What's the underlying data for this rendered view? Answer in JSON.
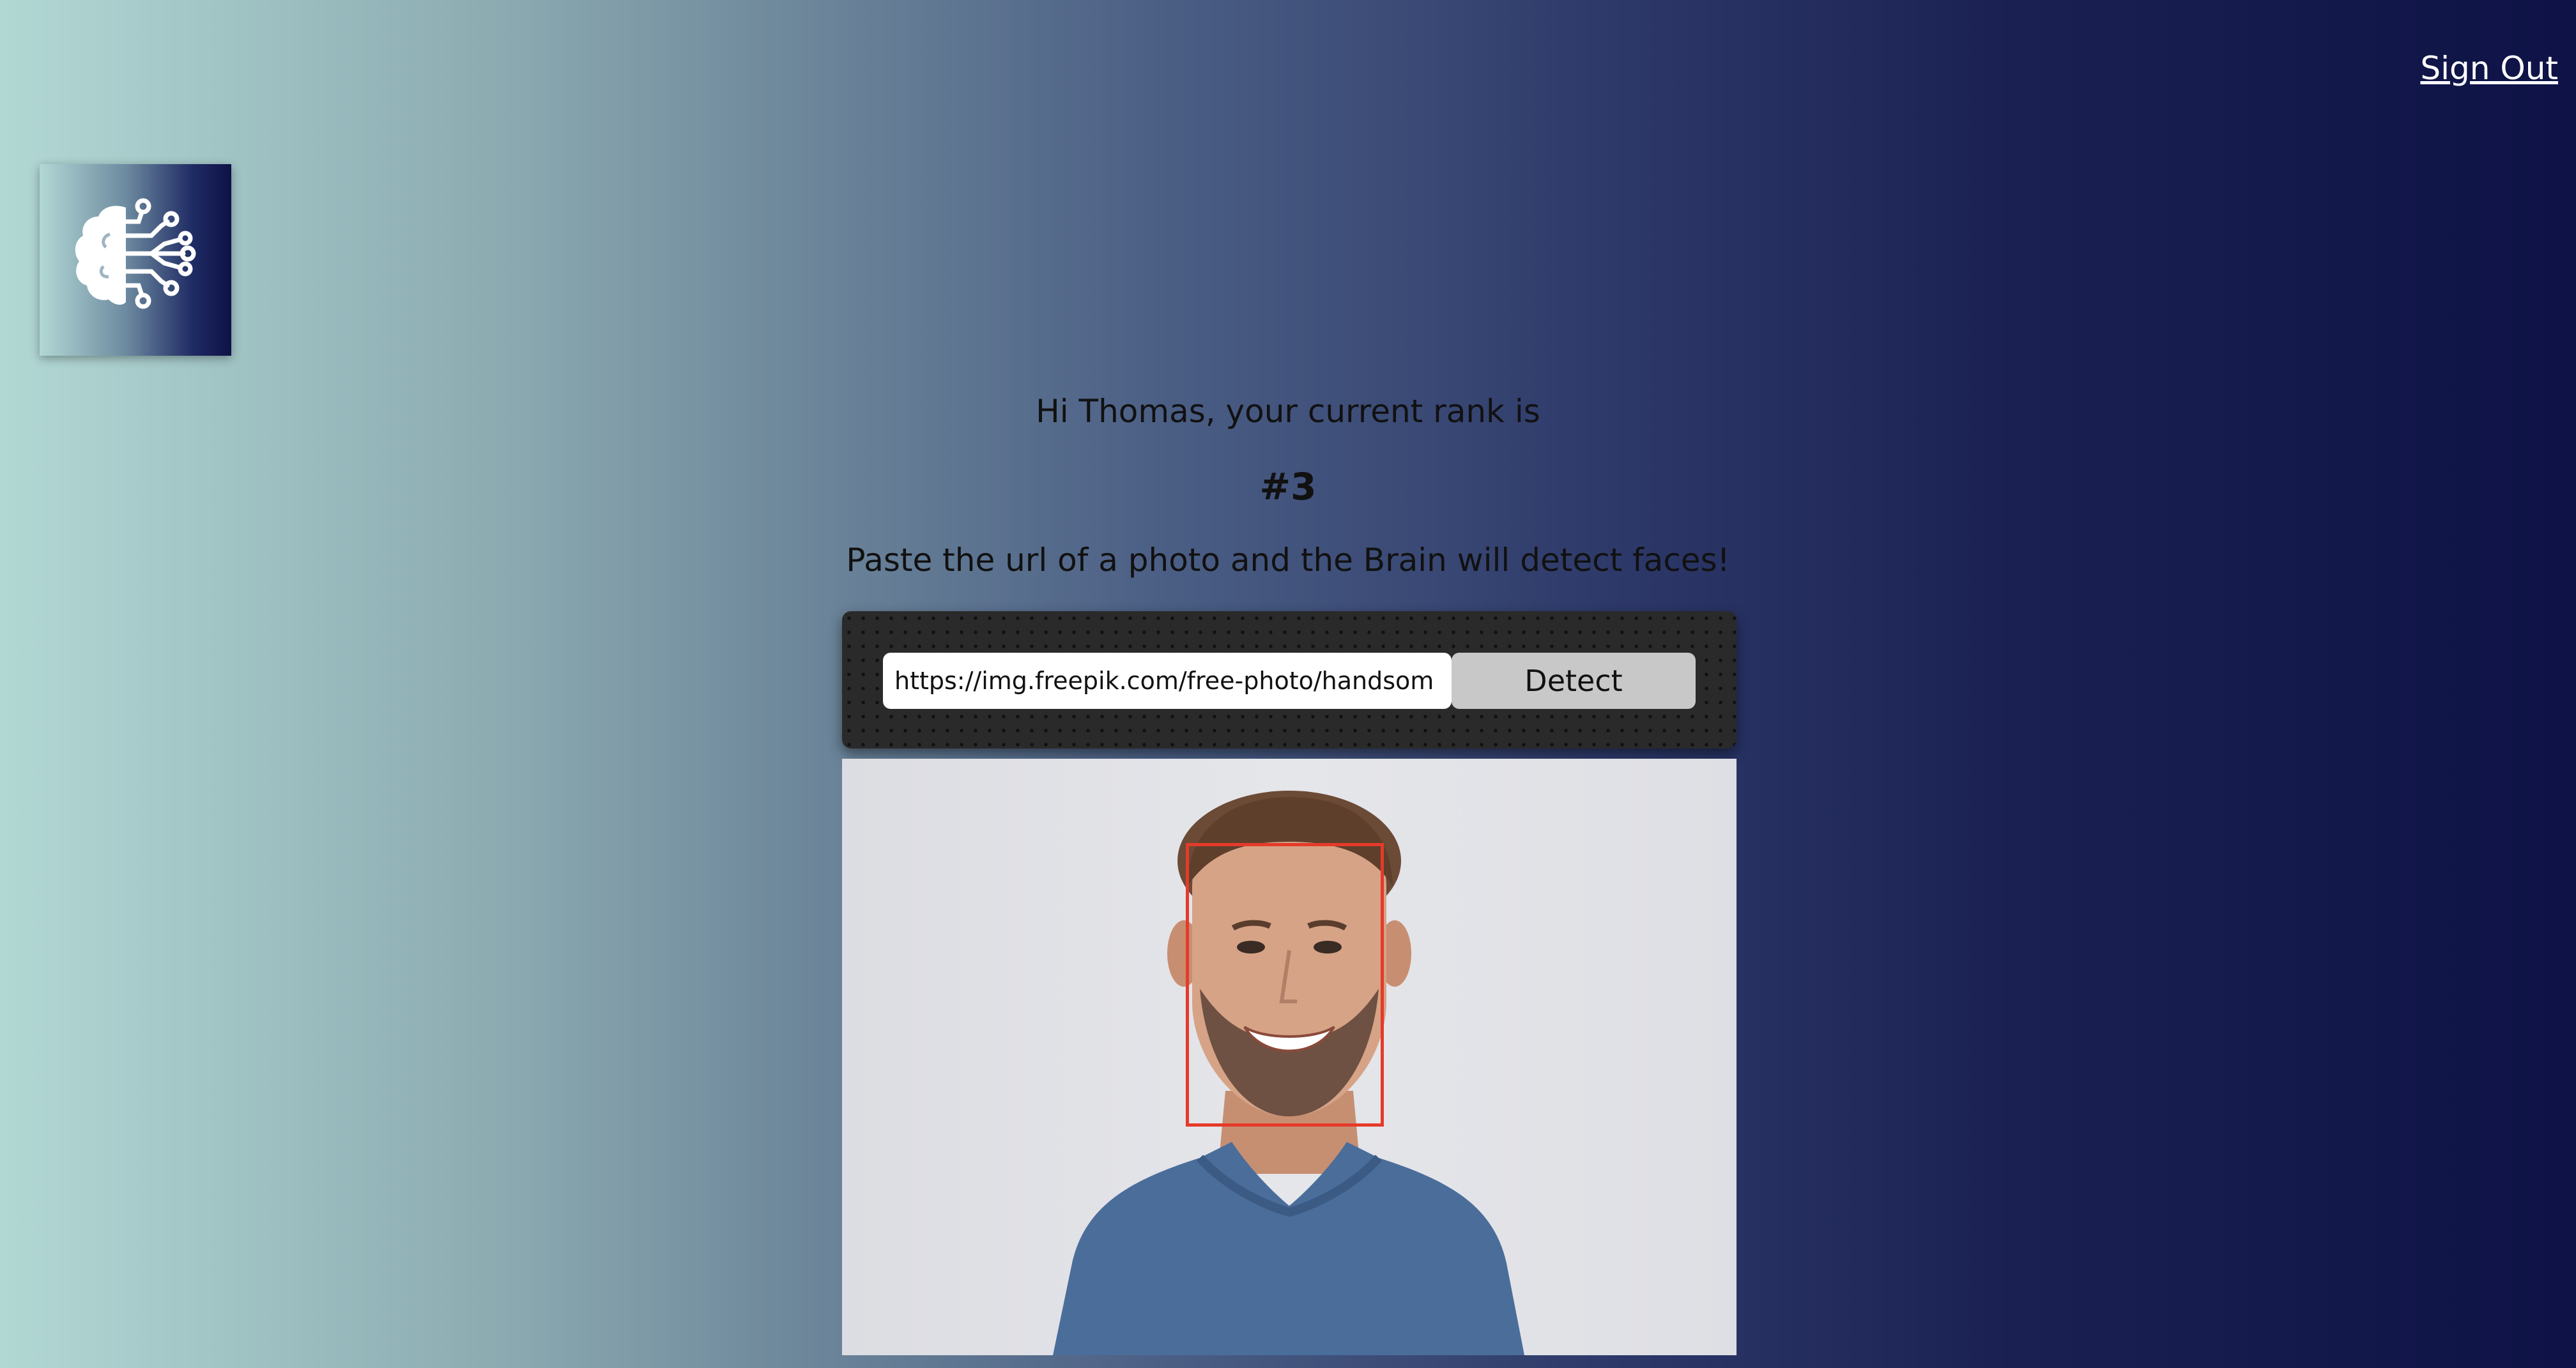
{
  "nav": {
    "sign_out": "Sign Out"
  },
  "logo": {
    "icon": "brain-circuit-icon"
  },
  "rank": {
    "greeting": "Hi Thomas, your current rank is",
    "value": "#3"
  },
  "instructions": "Paste the url of a photo and the Brain will detect faces!",
  "form": {
    "url_value": "https://img.freepik.com/free-photo/handsom",
    "detect_label": "Detect"
  },
  "colors": {
    "face_box": "#e53a2a",
    "background_start": "#b2d8d4",
    "background_end": "#0e1246"
  }
}
